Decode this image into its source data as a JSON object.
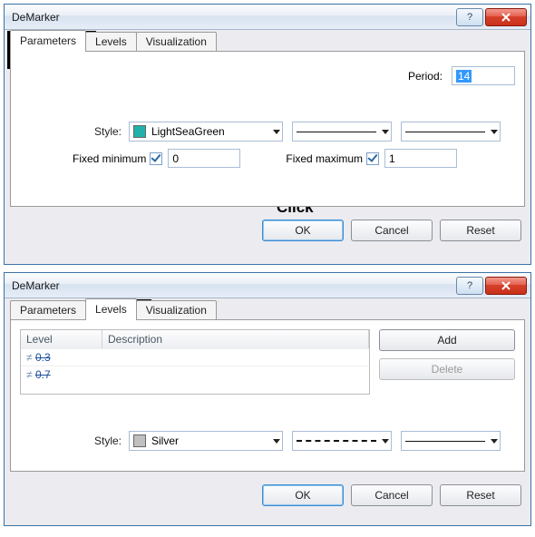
{
  "annotations": {
    "click": "Click"
  },
  "dialog1": {
    "title": "DeMarker",
    "tabs": [
      "Parameters",
      "Levels",
      "Visualization"
    ],
    "active_tab": 0,
    "period_label": "Period:",
    "period_value": "14",
    "style_label": "Style:",
    "style_color_name": "LightSeaGreen",
    "style_color_hex": "#20b2aa",
    "fixed_min_label": "Fixed minimum",
    "fixed_min_checked": true,
    "fixed_min_value": "0",
    "fixed_max_label": "Fixed maximum",
    "fixed_max_checked": true,
    "fixed_max_value": "1",
    "ok": "OK",
    "cancel": "Cancel",
    "reset": "Reset"
  },
  "dialog2": {
    "title": "DeMarker",
    "tabs": [
      "Parameters",
      "Levels",
      "Visualization"
    ],
    "active_tab": 1,
    "table": {
      "col_level": "Level",
      "col_desc": "Description",
      "rows": [
        {
          "level": "0.3",
          "desc": ""
        },
        {
          "level": "0.7",
          "desc": ""
        }
      ]
    },
    "add": "Add",
    "delete": "Delete",
    "style_label": "Style:",
    "style_color_name": "Silver",
    "style_color_hex": "#c0c0c0",
    "ok": "OK",
    "cancel": "Cancel",
    "reset": "Reset"
  }
}
